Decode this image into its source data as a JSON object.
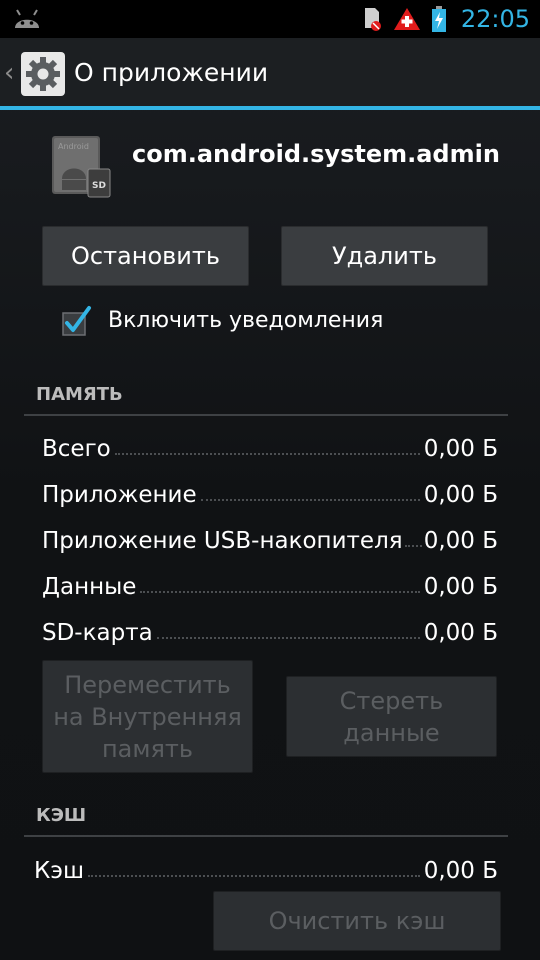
{
  "status_bar": {
    "time": "22:05",
    "icons": [
      "android-icon",
      "sd-card-error-icon",
      "warning-icon",
      "battery-charging-icon"
    ]
  },
  "action_bar": {
    "title": "О приложении",
    "icon": "settings-gear-icon"
  },
  "app": {
    "package_name": "com.android.system.admin",
    "icon_badge": "SD",
    "icon_label": "Android"
  },
  "buttons": {
    "stop": "Остановить",
    "uninstall": "Удалить"
  },
  "notifications": {
    "label": "Включить уведомления",
    "checked": true
  },
  "storage": {
    "header": "ПАМЯТЬ",
    "rows": [
      {
        "label": "Всего",
        "value": "0,00  Б"
      },
      {
        "label": "Приложение",
        "value": "0,00  Б"
      },
      {
        "label": "Приложение USB-накопителя",
        "value": "0,00  Б"
      },
      {
        "label": "Данные",
        "value": "0,00  Б"
      },
      {
        "label": "SD-карта",
        "value": "0,00  Б"
      }
    ],
    "move_button": "Переместить на Внутренняя память",
    "clear_data_button": "Стереть данные"
  },
  "cache": {
    "header": "КЭШ",
    "label": "Кэш",
    "value": "0,00  Б",
    "clear_button": "Очистить кэш"
  },
  "colors": {
    "accent": "#33b5e5",
    "warning": "#e11c1c"
  }
}
